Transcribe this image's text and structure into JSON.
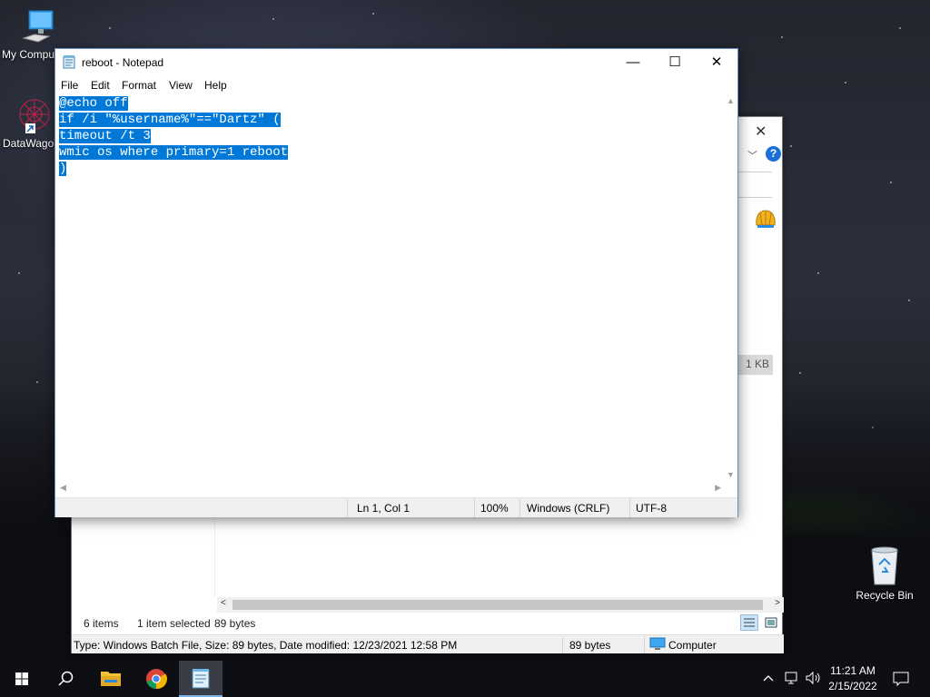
{
  "desktop": {
    "icons": [
      {
        "label": "My Compu"
      },
      {
        "label": "DataWago"
      },
      {
        "label": "Recycle Bin"
      }
    ]
  },
  "explorer": {
    "size_cell": "1 KB",
    "status": {
      "items": "6 items",
      "selected": "1 item selected",
      "bytes": "89 bytes"
    },
    "details": {
      "type_info": "Type: Windows Batch File, Size: 89 bytes, Date modified: 12/23/2021 12:58 PM",
      "size": "89 bytes",
      "location": "Computer"
    }
  },
  "notepad": {
    "title": "reboot - Notepad",
    "menu": [
      "File",
      "Edit",
      "Format",
      "View",
      "Help"
    ],
    "lines": [
      "@echo off",
      "if /i \"%username%\"==\"Dartz\" (",
      "timeout /t 3",
      "wmic os where primary=1 reboot",
      ")"
    ],
    "status": {
      "position": "Ln 1, Col 1",
      "zoom": "100%",
      "line_ending": "Windows (CRLF)",
      "encoding": "UTF-8"
    }
  },
  "taskbar": {
    "time": "11:21 AM",
    "date": "2/15/2022"
  },
  "colors": {
    "selection": "#0078d7",
    "taskbar": "#0d0f14",
    "accent": "#1a6fd8"
  }
}
